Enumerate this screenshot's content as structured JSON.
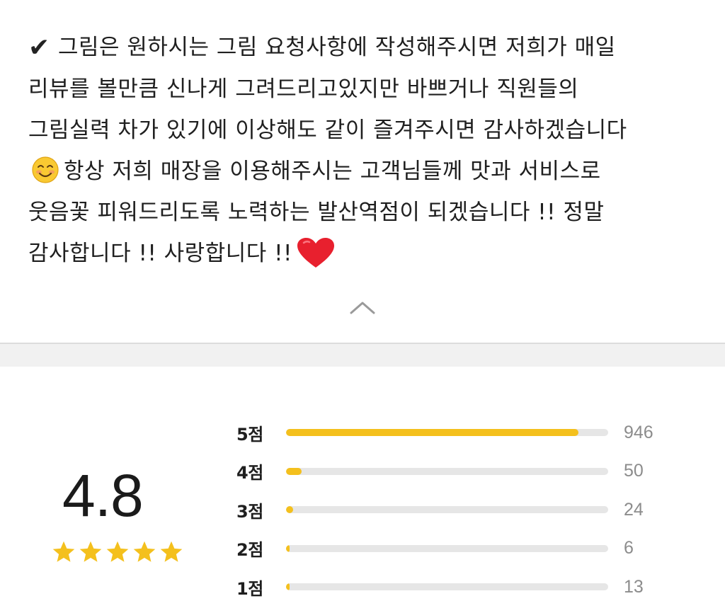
{
  "review": {
    "lines": [
      "그림은 원하시는 그림 요청사항에 작성해주시면 저희가 매일",
      "리뷰를 볼만큼 신나게 그려드리고있지만 바쁘거나 직원들의",
      "그림실력 차가 있기에 이상해도 같이 즐겨주시면 감사하겠습니다",
      "항상 저희 매장을 이용해주시는 고객님들께 맛과 서비스로",
      "웃음꽃 피워드리도록 노력하는 발산역점이 되겠습니다 !! 정말",
      "감사합니다 !! 사랑합니다 !!"
    ],
    "check_icon": "check-mark-icon",
    "smile_icon": "smiling-face-icon",
    "heart_icon": "red-heart-icon",
    "check_glyph": "✔"
  },
  "collapse": {
    "icon": "chevron-up-icon"
  },
  "rating": {
    "score": "4.8",
    "star_count": 5,
    "star_color": "#f4c01d",
    "distribution": [
      {
        "label": "5점",
        "count": "946",
        "fraction": 0.908
      },
      {
        "label": "4점",
        "count": "50",
        "fraction": 0.048
      },
      {
        "label": "3점",
        "count": "24",
        "fraction": 0.023
      },
      {
        "label": "2점",
        "count": "6",
        "fraction": 0.006
      },
      {
        "label": "1점",
        "count": "13",
        "fraction": 0.012
      }
    ]
  },
  "colors": {
    "accent": "#f4c01d",
    "track": "#e6e6e6",
    "heart": "#e8202e"
  }
}
